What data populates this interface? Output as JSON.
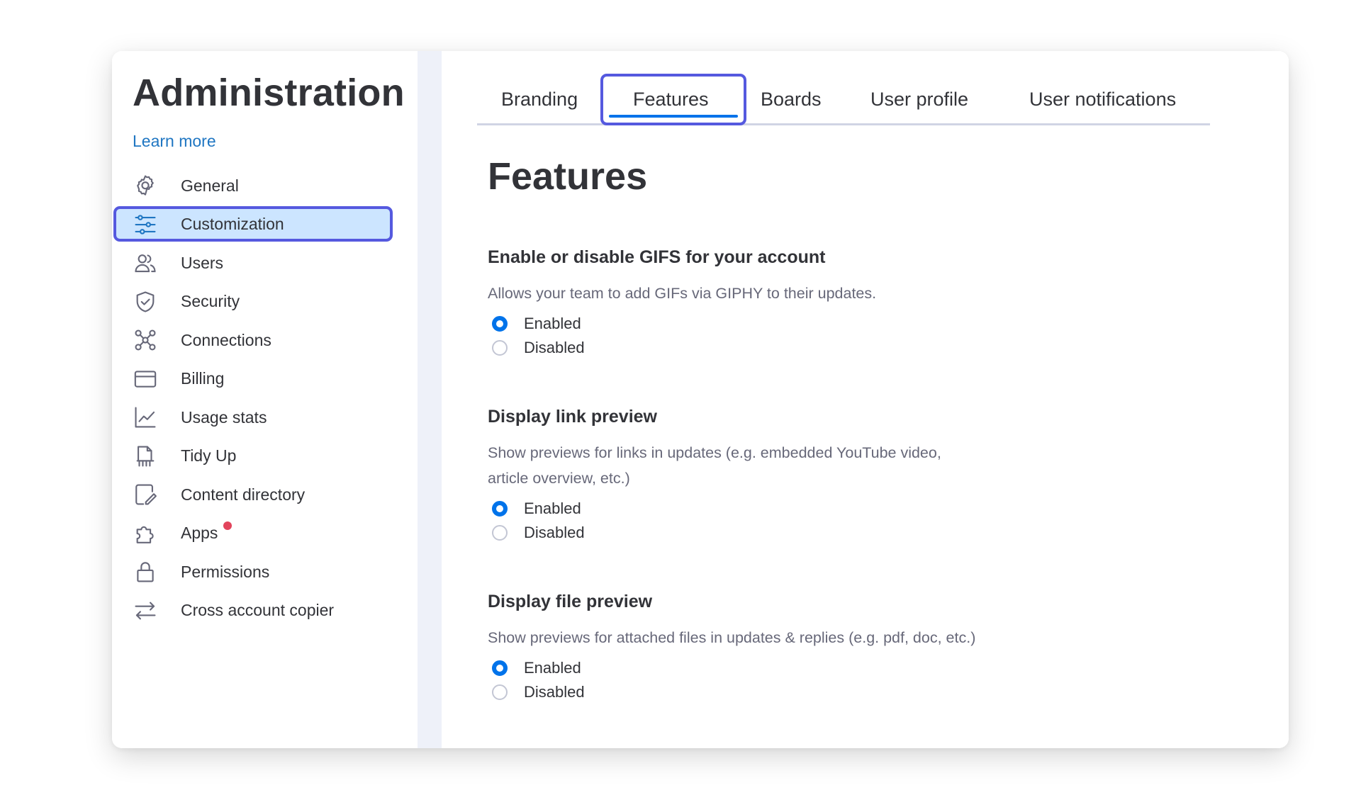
{
  "sidebar": {
    "title": "Administration",
    "learn_more": "Learn more",
    "items": [
      {
        "label": "General",
        "icon": "gear-icon"
      },
      {
        "label": "Customization",
        "icon": "sliders-icon",
        "active": true
      },
      {
        "label": "Users",
        "icon": "users-icon"
      },
      {
        "label": "Security",
        "icon": "shield-icon"
      },
      {
        "label": "Connections",
        "icon": "connections-icon"
      },
      {
        "label": "Billing",
        "icon": "credit-card-icon"
      },
      {
        "label": "Usage stats",
        "icon": "chart-icon"
      },
      {
        "label": "Tidy Up",
        "icon": "broom-icon"
      },
      {
        "label": "Content directory",
        "icon": "edit-document-icon"
      },
      {
        "label": "Apps",
        "icon": "puzzle-icon",
        "notification_dot": true
      },
      {
        "label": "Permissions",
        "icon": "lock-icon"
      },
      {
        "label": "Cross account copier",
        "icon": "transfer-arrows-icon"
      }
    ]
  },
  "tabs": [
    {
      "label": "Branding"
    },
    {
      "label": "Features",
      "active": true
    },
    {
      "label": "Boards"
    },
    {
      "label": "User profile"
    },
    {
      "label": "User notifications"
    }
  ],
  "main": {
    "title": "Features",
    "sections": [
      {
        "title": "Enable or disable GIFS for your account",
        "description": "Allows your team to add GIFs via GIPHY to their updates.",
        "options": [
          "Enabled",
          "Disabled"
        ],
        "selected": "Enabled"
      },
      {
        "title": "Display link preview",
        "description": "Show previews for links in updates (e.g. embedded YouTube video, article overview, etc.)",
        "options": [
          "Enabled",
          "Disabled"
        ],
        "selected": "Enabled"
      },
      {
        "title": "Display file preview",
        "description": "Show previews for attached files in updates & replies (e.g. pdf, doc, etc.)",
        "options": [
          "Enabled",
          "Disabled"
        ],
        "selected": "Enabled"
      }
    ]
  },
  "colors": {
    "accent": "#0073ea",
    "focus_ring": "#5559df",
    "active_bg": "#cce5ff",
    "link": "#1f76c2",
    "notification": "#e2445c"
  }
}
